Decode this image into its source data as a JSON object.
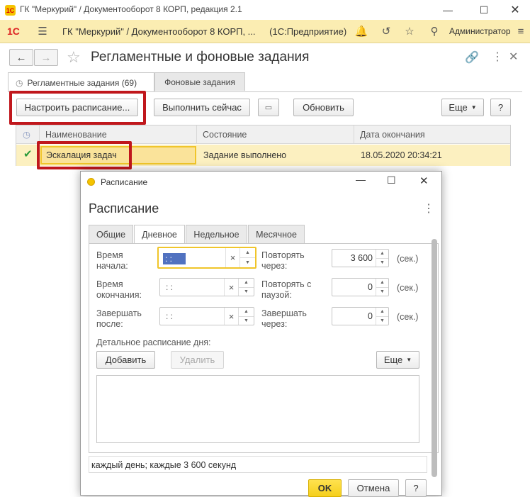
{
  "window": {
    "title": "ГК \"Меркурий\" / Документооборот 8 КОРП, редакция 2.1"
  },
  "appbar": {
    "title": "ГК \"Меркурий\" / Документооборот 8 КОРП, ...",
    "mode": "(1С:Предприятие)",
    "user": "Администратор",
    "logo": "1С"
  },
  "form": {
    "title": "Регламентные и фоновые задания"
  },
  "tabs": [
    {
      "label": "Регламентные задания (69)"
    },
    {
      "label": "Фоновые задания"
    }
  ],
  "toolbar": {
    "schedule": "Настроить расписание...",
    "run_now": "Выполнить сейчас",
    "refresh": "Обновить",
    "more": "Еще",
    "help": "?"
  },
  "table": {
    "headers": [
      "Наименование",
      "Состояние",
      "Дата окончания"
    ],
    "rows": [
      {
        "name": "Эскалация задач",
        "state": "Задание выполнено",
        "end": "18.05.2020 20:34:21"
      }
    ]
  },
  "dialog": {
    "title": "Расписание",
    "heading": "Расписание",
    "tabs": [
      "Общие",
      "Дневное",
      "Недельное",
      "Месячное"
    ],
    "start_label": "Время начала:",
    "end_label": "Время окончания:",
    "finish_label": "Завершать после:",
    "time_value": " :  :",
    "repeat_label": "Повторять через:",
    "repeat_value": "3 600",
    "pause_label": "Повторять с паузой:",
    "pause_value": "0",
    "finish_in_label": "Завершать через:",
    "finish_in_value": "0",
    "unit": "(сек.)",
    "detail_label": "Детальное расписание дня:",
    "add": "Добавить",
    "delete": "Удалить",
    "more": "Еще",
    "summary": "каждый день; каждые 3 600 секунд",
    "ok": "OK",
    "cancel": "Отмена",
    "help": "?"
  }
}
